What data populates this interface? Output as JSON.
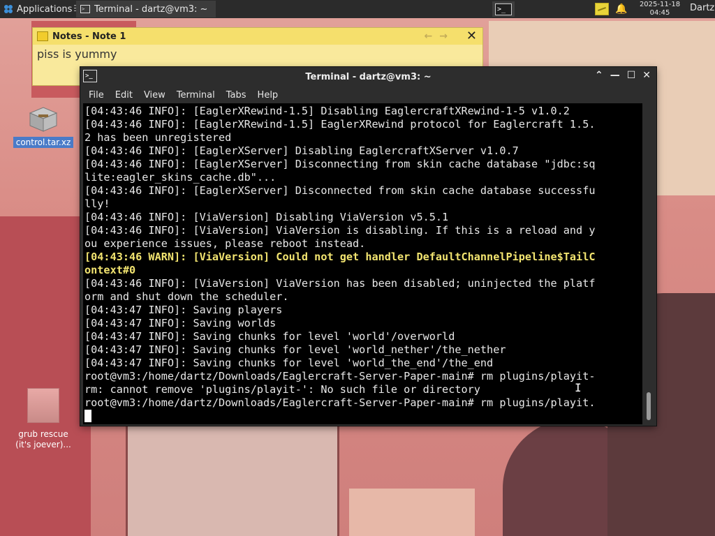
{
  "panel": {
    "apps_label": "Applications",
    "apps_sep": "☰",
    "task_title": "Terminal - dartz@vm3: ~",
    "clock_date": "2025-11-18",
    "clock_time": "04:45",
    "user": "Dartz",
    "launcher_glyph": ">_"
  },
  "desktop": {
    "icons": [
      {
        "label": "control.tar.xz",
        "selected": true
      },
      {
        "label": "grub rescue\n(it's joever)..."
      }
    ]
  },
  "notes": {
    "title": "Notes - Note 1",
    "body": "piss  is yummy",
    "nav_glyphs": "←→",
    "close_glyph": "✕"
  },
  "terminal": {
    "title": "Terminal - dartz@vm3: ~",
    "menu": [
      "File",
      "Edit",
      "View",
      "Terminal",
      "Tabs",
      "Help"
    ],
    "lines": [
      {
        "text": "[04:43:46 INFO]: [EaglerXRewind-1.5] Disabling EaglercraftXRewind-1-5 v1.0.2"
      },
      {
        "text": "[04:43:46 INFO]: [EaglerXRewind-1.5] EaglerXRewind protocol for Eaglercraft 1.5."
      },
      {
        "text": "2 has been unregistered"
      },
      {
        "text": "[04:43:46 INFO]: [EaglerXServer] Disabling EaglercraftXServer v1.0.7"
      },
      {
        "text": "[04:43:46 INFO]: [EaglerXServer] Disconnecting from skin cache database \"jdbc:sq"
      },
      {
        "text": "lite:eagler_skins_cache.db\"..."
      },
      {
        "text": "[04:43:46 INFO]: [EaglerXServer] Disconnected from skin cache database successfu"
      },
      {
        "text": "lly!"
      },
      {
        "text": "[04:43:46 INFO]: [ViaVersion] Disabling ViaVersion v5.5.1"
      },
      {
        "text": "[04:43:46 INFO]: [ViaVersion] ViaVersion is disabling. If this is a reload and y"
      },
      {
        "text": "ou experience issues, please reboot instead."
      },
      {
        "text": "[04:43:46 WARN]: [ViaVersion] Could not get handler DefaultChannelPipeline$TailC",
        "level": "warn"
      },
      {
        "text": "ontext#0",
        "level": "warn"
      },
      {
        "text": "[04:43:46 INFO]: [ViaVersion] ViaVersion has been disabled; uninjected the platf"
      },
      {
        "text": "orm and shut down the scheduler."
      },
      {
        "text": "[04:43:47 INFO]: Saving players"
      },
      {
        "text": "[04:43:47 INFO]: Saving worlds"
      },
      {
        "text": "[04:43:47 INFO]: Saving chunks for level 'world'/overworld"
      },
      {
        "text": "[04:43:47 INFO]: Saving chunks for level 'world_nether'/the_nether"
      },
      {
        "text": "[04:43:47 INFO]: Saving chunks for level 'world_the_end'/the_end"
      },
      {
        "text": "root@vm3:/home/dartz/Downloads/Eaglercraft-Server-Paper-main# rm plugins/playit-"
      },
      {
        "text": "rm: cannot remove 'plugins/playit-': No such file or directory"
      },
      {
        "text": "root@vm3:/home/dartz/Downloads/Eaglercraft-Server-Paper-main# rm plugins/playit."
      }
    ]
  },
  "colors": {
    "terminal_bg": "#000000",
    "terminal_fg": "#e8e8e8",
    "warn_fg": "#f2e470",
    "panel_bg": "#2b2b2b",
    "notes_bg": "#f9e99c",
    "selection": "#4a7bc8"
  }
}
